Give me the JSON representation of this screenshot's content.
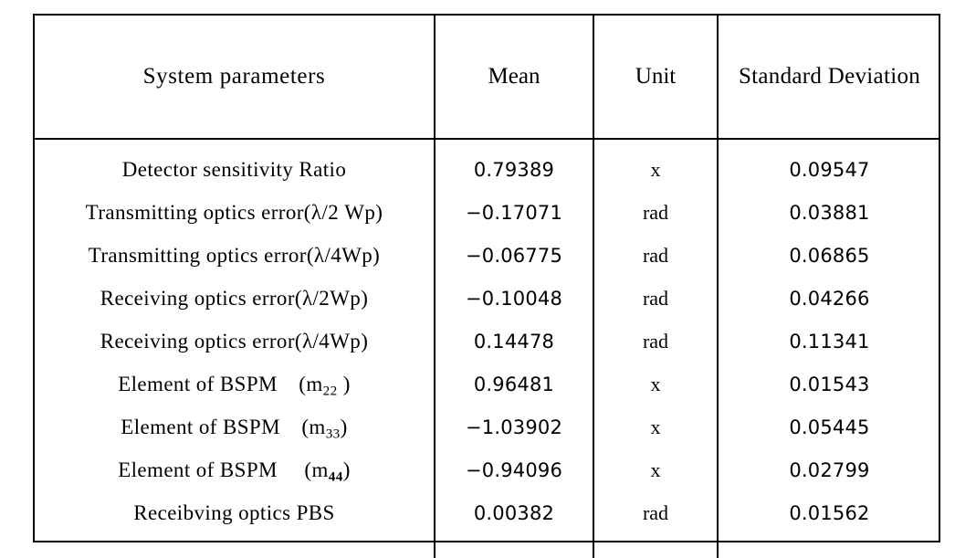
{
  "table": {
    "headers": [
      "System parameters",
      "Mean",
      "Unit",
      "Standard Deviation"
    ],
    "rows": [
      {
        "parameter": "Detector sensitivity Ratio",
        "parameter_base": "Detector sensitivity Ratio",
        "parameter_sub": "",
        "parameter_tail": "",
        "mean": "0.79389",
        "unit": "x",
        "std": "0.09547"
      },
      {
        "parameter": "Transmitting optics error(λ/2 Wp)",
        "parameter_base": "Transmitting optics error(λ/2 Wp)",
        "parameter_sub": "",
        "parameter_tail": "",
        "mean": "−0.17071",
        "unit": "rad",
        "std": "0.03881"
      },
      {
        "parameter": "Transmitting optics error(λ/4Wp)",
        "parameter_base": "Transmitting optics error(λ/4Wp)",
        "parameter_sub": "",
        "parameter_tail": "",
        "mean": "−0.06775",
        "unit": "rad",
        "std": "0.06865"
      },
      {
        "parameter": "Receiving optics error(λ/2Wp)",
        "parameter_base": "Receiving optics error(λ/2Wp)",
        "parameter_sub": "",
        "parameter_tail": "",
        "mean": "−0.10048",
        "unit": "rad",
        "std": "0.04266"
      },
      {
        "parameter": "Receiving optics error(λ/4Wp)",
        "parameter_base": "Receiving optics error(λ/4Wp)",
        "parameter_sub": "",
        "parameter_tail": "",
        "mean": "0.14478",
        "unit": "rad",
        "std": "0.11341"
      },
      {
        "parameter": "Element of BSPM (m22 )",
        "parameter_base": "Element of BSPM (m",
        "parameter_sub": "22",
        "parameter_tail": " )",
        "mean": "0.96481",
        "unit": "x",
        "std": "0.01543"
      },
      {
        "parameter": "Element of BSPM (m33)",
        "parameter_base": "Element of BSPM (m",
        "parameter_sub": "33",
        "parameter_tail": ")",
        "mean": "−1.03902",
        "unit": "x",
        "std": "0.05445"
      },
      {
        "parameter": "Element of BSPM  (m44)",
        "parameter_base": "Element of BSPM  (m",
        "parameter_sub": "44",
        "parameter_tail": ")",
        "mean": "−0.94096",
        "unit": "x",
        "std": "0.02799"
      },
      {
        "parameter": "Receibving optics PBS",
        "parameter_base": "Receibving optics PBS",
        "parameter_sub": "",
        "parameter_tail": "",
        "mean": "0.00382",
        "unit": "rad",
        "std": "0.01562"
      }
    ]
  },
  "colors": {
    "border": "#000000",
    "text": "#000000",
    "background": "#ffffff"
  }
}
